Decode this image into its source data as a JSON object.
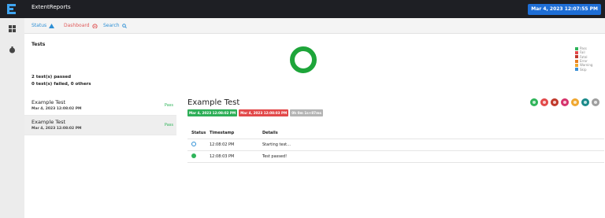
{
  "app": {
    "title": "ExtentReports",
    "date": "Mar 4, 2023 12:07:55 PM"
  },
  "nav": {
    "status": "Status",
    "dashboard": "Dashboard",
    "search": "Search"
  },
  "overview": {
    "title": "Tests",
    "summary_line1": "2 test(s) passed",
    "summary_line2": "0 test(s) failed, 0 others",
    "legend": [
      {
        "label": "Pass",
        "color": "#2fb45a"
      },
      {
        "label": "Fail",
        "color": "#e2494a"
      },
      {
        "label": "Fatal",
        "color": "#c0392b"
      },
      {
        "label": "Error",
        "color": "#e67e22"
      },
      {
        "label": "Warning",
        "color": "#f0a830"
      },
      {
        "label": "Skip",
        "color": "#3a8fd6"
      }
    ],
    "chart_data": {
      "type": "pie",
      "categories": [
        "Pass",
        "Fail",
        "Others"
      ],
      "values": [
        2,
        0,
        0
      ]
    }
  },
  "tests": [
    {
      "name": "Example Test",
      "time": "Mar 4, 2023 12:08:02 PM",
      "status": "Pass"
    },
    {
      "name": "Example Test",
      "time": "Mar 4, 2023 12:08:02 PM",
      "status": "Pass"
    }
  ],
  "detail": {
    "title": "Example Test",
    "start": "Mar 4, 2023 12:08:02 PM",
    "end": "Mar 4, 2023 12:08:03 PM",
    "duration": "0h 0m 1s+87ms",
    "action_colors": [
      "#2fb45a",
      "#e2494a",
      "#c0392b",
      "#d6336c",
      "#f0a830",
      "#1a8a8a",
      "#9e9e9e"
    ],
    "log_headers": {
      "status": "Status",
      "timestamp": "Timestamp",
      "details": "Details"
    },
    "logs": [
      {
        "status": "info",
        "timestamp": "12:08:02 PM",
        "details": "Starting test..."
      },
      {
        "status": "pass",
        "timestamp": "12:08:03 PM",
        "details": "Test passed!"
      }
    ]
  }
}
